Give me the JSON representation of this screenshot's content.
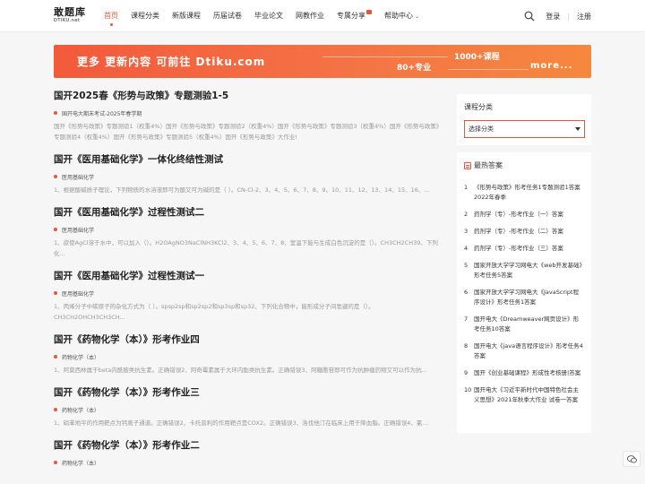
{
  "logo": {
    "cn": "敢题库",
    "en": "DTIKU.net"
  },
  "nav": [
    {
      "label": "首页",
      "active": true
    },
    {
      "label": "课程分类"
    },
    {
      "label": "新版课程"
    },
    {
      "label": "历届试卷"
    },
    {
      "label": "毕业论文"
    },
    {
      "label": "网教作业"
    },
    {
      "label": "专属分享"
    },
    {
      "label": "帮助中心"
    }
  ],
  "header": {
    "login": "登录",
    "register": "注册",
    "separator": "|"
  },
  "banner": {
    "text": "更多 更新内容 可前往 Dtiku.com",
    "tag1": "1000+课程",
    "tag2": "80+专业",
    "more": "more..."
  },
  "articles": [
    {
      "title": "国开2025春《形势与政策》专题测验1-5",
      "meta": "国开电大期末考试-2025年春学期",
      "desc": "国开《形势与政策》专题测验1（权重4%）国开《形势与政策》专题测验2（权重4%）国开《形势与政策》专题测验3（权重4%）国开《形势与政策》专题测验4（权重4%）国开《形势与政策》专题测验5（权重4%）国开《形势与政策》大作业!"
    },
    {
      "title": "国开《医用基础化学》一体化终结性测试",
      "meta": "医用基础化学",
      "desc": "1、根据酸碱质子理论，下列物质的水溶液即可为酸又可为碱的是（ ）。CN-Cl-2、3、4、5、6、7、8、9、10、11、12、13、14、15、16、..."
    },
    {
      "title": "国开《医用基础化学》过程性测试二",
      "meta": "医用基础化学",
      "desc": "1、欲使AgCl溶于水中，可以加入（）。H2OAgNO3NaClNH3KCl2、3、4、5、6、7、8、室温下能与生成白色沉淀的是（）。CH3CH2CH39、下列化..."
    },
    {
      "title": "国开《医用基础化学》过程性测试一",
      "meta": "医用基础化学",
      "desc": "1、丙烯分子中碳原子的杂化方式为（ ）。spsp2sp和sp2sp2和sp3sp和sp32、下列化合物中，能形成分子间氢键的是（）。CH3CH2OHCH3CH3CH..."
    },
    {
      "title": "国开《药物化学（本）》形考作业四",
      "meta": "药物化学（本）",
      "desc": "1、阿莫西林属于beta内酰胺类抗生素。正确错误2、阿奇霉素属于大环内酯类抗生素。正确错误3、阿糖胞苷即可作为抗肿瘤药物又可以作为抗..."
    },
    {
      "title": "国开《药物化学（本）》形考作业三",
      "meta": "药物化学（本）",
      "desc": "1、硝苯地平的作用靶点为钙离子通道。正确错误2、卡托普利的作用靶点是COX2。正确错误3、洛伐他汀在临床上用于降血脂。正确错误4、氯..."
    },
    {
      "title": "国开《药物化学（本）》形考作业二",
      "meta": "药物化学（本）",
      "desc": ""
    }
  ],
  "category": {
    "title": "课程分类",
    "select": "选择分类"
  },
  "hot": {
    "title": "最热答案",
    "items": [
      "《形势与政策》形考任务1专题测验1答案 2022年春季",
      "药剂学（专）-形考作业（一）答案",
      "药剂学（专）-形考作业（二）答案",
      "药剂学（专）-形考作业（三）答案",
      "国家开放大学学习网电大《web开发基础》形考任务5答案",
      "国家开放大学学习网电大《JavaScript程序设计》形考任务1答案",
      "国开电大《Dreamweaver网页设计》形考任务10答案",
      "国开电大《java语言程序设计》形考任务4答案",
      "国开《创业基础课程》形成性考核册|答案",
      "国开电大《习近平新时代中国特色社会主义思想》2021年秋季大作业 试卷一答案"
    ]
  }
}
